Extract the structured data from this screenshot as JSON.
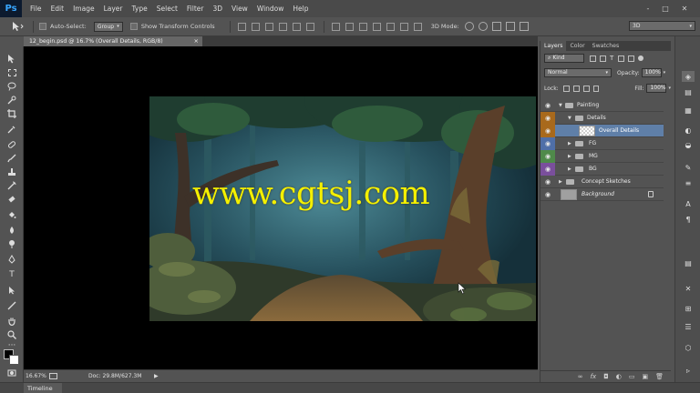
{
  "app": {
    "logo": "Ps",
    "menu": [
      "File",
      "Edit",
      "Image",
      "Layer",
      "Type",
      "Select",
      "Filter",
      "3D",
      "View",
      "Window",
      "Help"
    ],
    "window_controls": [
      "-",
      "□",
      "✕"
    ]
  },
  "options_bar": {
    "auto_select_label": "Auto-Select:",
    "auto_select_target": "Group",
    "transform_label": "Show Transform Controls",
    "mode_3d_label": "3D Mode:",
    "workspace": "3D"
  },
  "document": {
    "tab_title": "12_begin.psd @ 16.7% (Overall Details, RGB/8)",
    "close_glyph": "×",
    "watermark": "www.cgtsj.com"
  },
  "status": {
    "zoom": "16.67%",
    "doc_info": "Doc: 29.8M/627.3M",
    "arrow": "▶"
  },
  "timeline": {
    "label": "Timeline"
  },
  "layers_panel": {
    "tabs": [
      "Layers",
      "Color",
      "Swatches"
    ],
    "filter_label": "Kind",
    "blend_mode": "Normal",
    "opacity_label": "Opacity:",
    "opacity_value": "100%",
    "lock_label": "Lock:",
    "fill_label": "Fill:",
    "fill_value": "100%",
    "layers": [
      {
        "name": "Painting",
        "indent": 0,
        "type": "group",
        "open": true,
        "color": ""
      },
      {
        "name": "Details",
        "indent": 1,
        "type": "group",
        "open": true,
        "color": "#a8691c"
      },
      {
        "name": "Overall Details",
        "indent": 2,
        "type": "layer",
        "selected": true,
        "color": "#a8691c"
      },
      {
        "name": "FG",
        "indent": 1,
        "type": "group",
        "open": false,
        "color": "#4f6fa8"
      },
      {
        "name": "MG",
        "indent": 1,
        "type": "group",
        "open": false,
        "color": "#4f8a4a"
      },
      {
        "name": "BG",
        "indent": 1,
        "type": "group",
        "open": false,
        "color": "#7a4f9c"
      },
      {
        "name": "Concept Sketches",
        "indent": 0,
        "type": "group",
        "open": false,
        "color": ""
      },
      {
        "name": "Background",
        "indent": 0,
        "type": "background",
        "color": ""
      }
    ],
    "footer_icons": [
      "link-icon",
      "fx-icon",
      "mask-icon",
      "adjustment-icon",
      "folder-icon",
      "new-layer-icon",
      "trash-icon"
    ]
  },
  "colors": {
    "menubar": "#4a4a4a",
    "panel": "#535353",
    "selected_layer": "#5f7fa8",
    "watermark": "#f4f000",
    "ps_blue": "#38a6ff"
  }
}
